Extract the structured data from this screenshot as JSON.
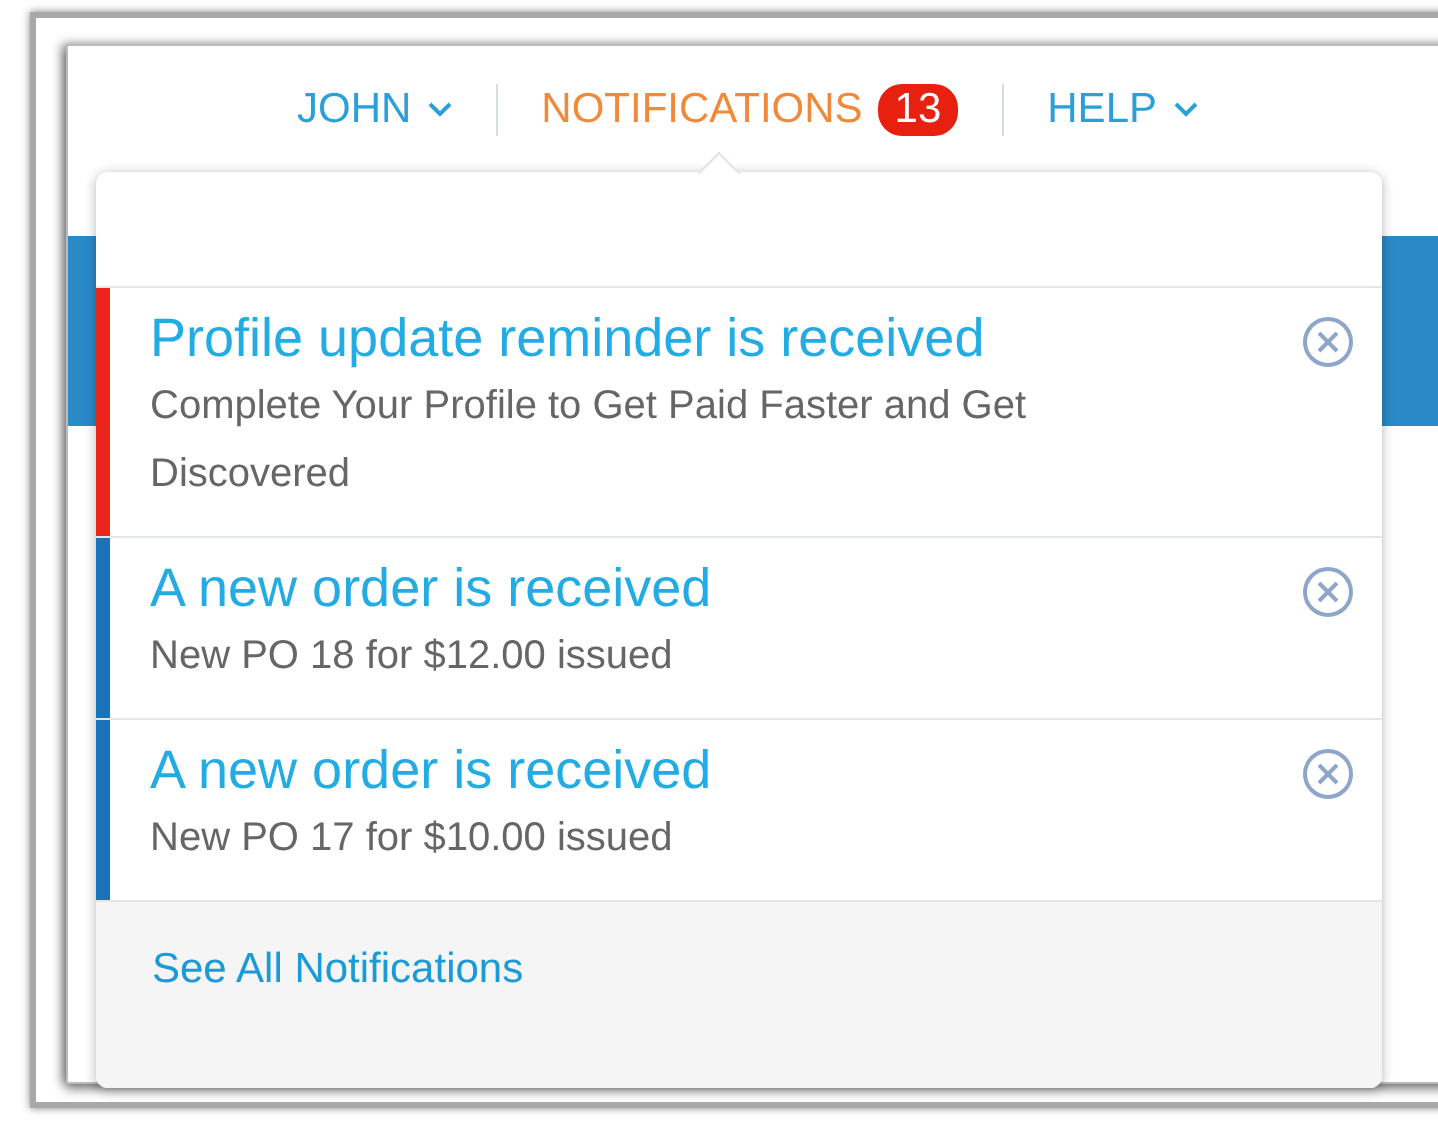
{
  "nav": [
    {
      "kind": "menu",
      "label": "JOHN",
      "selected": false
    },
    {
      "kind": "counter",
      "label": "NOTIFICATIONS",
      "badge": "13",
      "selected": true
    },
    {
      "kind": "menu",
      "label": "HELP",
      "selected": false
    }
  ],
  "notifications": [
    {
      "title": "Profile update reminder is received",
      "message": "Complete Your Profile to Get Paid Faster and Get Discovered",
      "color": "#e8261c"
    },
    {
      "title": "A new order is received",
      "message": "New PO 18 for $12.00 issued",
      "color": "#1a73b8"
    },
    {
      "title": "A new order is received",
      "message": "New PO 17 for $10.00 issued",
      "color": "#1a73b8"
    }
  ],
  "footer_link": "See All Notifications"
}
